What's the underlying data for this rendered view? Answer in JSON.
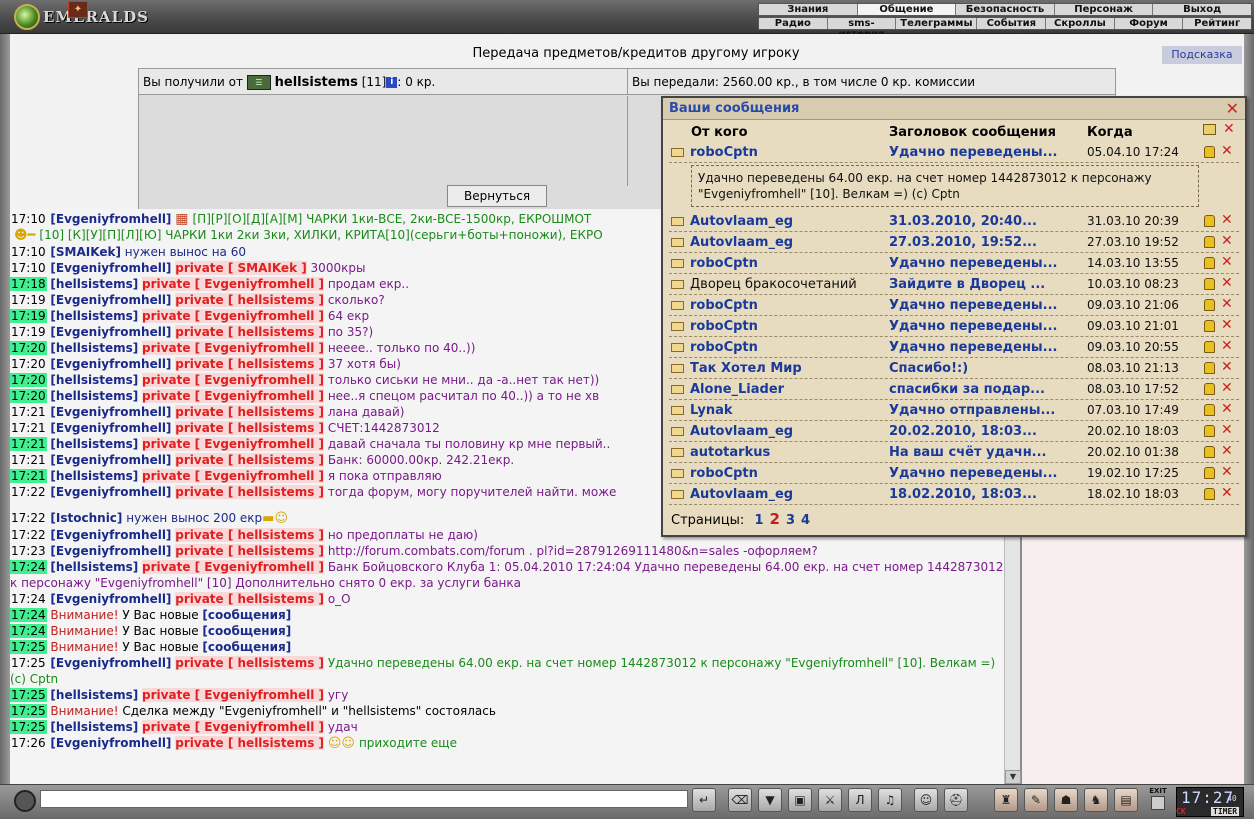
{
  "app": {
    "logo_text": "EMERALDS"
  },
  "nav": {
    "top": [
      "Знания",
      "Общение",
      "Безопасность",
      "Персонаж",
      "Выход"
    ],
    "active": "Общение",
    "sub": [
      "Радио",
      "sms-история",
      "Телеграммы",
      "События",
      "Скроллы",
      "Форум",
      "Рейтинг"
    ]
  },
  "transfer": {
    "title": "Передача предметов/кредитов другому игроку",
    "hint_button": "Подсказка",
    "received_prefix": "Вы получили от",
    "received_from": "hellsistems",
    "received_level": "[11]",
    "received_amount": ": 0 кр.",
    "sent_text": "Вы передали: 2560.00 кр., в том числе 0 кр. комиссии",
    "return_button": "Вернуться"
  },
  "chat": {
    "lines": [
      {
        "time": "17:10",
        "hl": false,
        "name": "Evgeniyfromhell",
        "priv": "",
        "text": "[П][Р][О][Д][А][М] ЧАРКИ 1ки-ВСЕ, 2ки-ВСЕ-1500кр, ЕКРОШМОТ",
        "style": "g",
        "icon_before": "brick"
      },
      {
        "time": "",
        "hl": false,
        "name": "",
        "priv": "",
        "text": "[10] [К][У][П][Л][Ю] ЧАРКИ 1ки 2ки 3ки, ХИЛКИ, КРИТА[10](серьги+боты+поножи), ЕКРО",
        "style": "g",
        "icon_before": "smile"
      },
      {
        "time": "17:10",
        "hl": false,
        "name": "SMAIKek",
        "priv": "",
        "text": "нужен вынос на 60",
        "style": "n2"
      },
      {
        "time": "17:10",
        "hl": false,
        "name": "Evgeniyfromhell",
        "priv": "SMAIKek",
        "text": "3000кры",
        "style": "m"
      },
      {
        "time": "17:18",
        "hl": true,
        "name": "hellsistems",
        "priv": "Evgeniyfromhell",
        "text": "продам екр..",
        "style": "m"
      },
      {
        "time": "17:19",
        "hl": false,
        "name": "Evgeniyfromhell",
        "priv": "hellsistems",
        "text": "сколько?",
        "style": "m"
      },
      {
        "time": "17:19",
        "hl": true,
        "name": "hellsistems",
        "priv": "Evgeniyfromhell",
        "text": "64 екр",
        "style": "m"
      },
      {
        "time": "17:19",
        "hl": false,
        "name": "Evgeniyfromhell",
        "priv": "hellsistems",
        "text": "по 35?)",
        "style": "m"
      },
      {
        "time": "17:20",
        "hl": true,
        "name": "hellsistems",
        "priv": "Evgeniyfromhell",
        "text": "нееее.. только по 40..))",
        "style": "m"
      },
      {
        "time": "17:20",
        "hl": false,
        "name": "Evgeniyfromhell",
        "priv": "hellsistems",
        "text": "37 хотя бы)",
        "style": "m"
      },
      {
        "time": "17:20",
        "hl": true,
        "name": "hellsistems",
        "priv": "Evgeniyfromhell",
        "text": "только сиськи не мни.. да -а..нет так нет))",
        "style": "m"
      },
      {
        "time": "17:20",
        "hl": true,
        "name": "hellsistems",
        "priv": "Evgeniyfromhell",
        "text": "нее..я спецом расчитал по 40..)) а то не хв",
        "style": "m"
      },
      {
        "time": "17:21",
        "hl": false,
        "name": "Evgeniyfromhell",
        "priv": "hellsistems",
        "text": "лана давай)",
        "style": "m"
      },
      {
        "time": "17:21",
        "hl": false,
        "name": "Evgeniyfromhell",
        "priv": "hellsistems",
        "text": "СЧЕТ:1442873012",
        "style": "m"
      },
      {
        "time": "17:21",
        "hl": true,
        "name": "hellsistems",
        "priv": "Evgeniyfromhell",
        "text": "давай сначала ты половину кр мне первый..",
        "style": "m"
      },
      {
        "time": "17:21",
        "hl": false,
        "name": "Evgeniyfromhell",
        "priv": "hellsistems",
        "text": "Банк: 60000.00кр. 242.21екр.",
        "style": "m"
      },
      {
        "time": "17:21",
        "hl": true,
        "name": "hellsistems",
        "priv": "Evgeniyfromhell",
        "text": "я пока отправляю",
        "style": "m"
      },
      {
        "time": "17:22",
        "hl": false,
        "name": "Evgeniyfromhell",
        "priv": "hellsistems",
        "text": "тогда форум, могу поручителей найти. може",
        "style": "m"
      },
      {
        "gap": true
      },
      {
        "time": "17:22",
        "hl": false,
        "name": "Istochnic",
        "priv": "",
        "text": "нужен вынос 200 екр",
        "style": "n2",
        "icon_after": "gun"
      },
      {
        "time": "17:22",
        "hl": false,
        "name": "Evgeniyfromhell",
        "priv": "hellsistems",
        "text": "но предоплаты не даю)",
        "style": "m"
      },
      {
        "time": "17:23",
        "hl": false,
        "name": "Evgeniyfromhell",
        "priv": "hellsistems",
        "text": "http://forum.combats.com/forum . pl?id=28791269111480&n=sales -офорляем?",
        "style": "m"
      },
      {
        "time": "17:24",
        "hl": true,
        "name": "hellsistems",
        "priv": "Evgeniyfromhell",
        "text": "Банк Бойцовского Клуба 1: 05.04.2010 17:24:04 Удачно переведены 64.00 екр. на счет номер 1442873012 к персонажу \"Evgeniyfromhell\" [10] Дополнительно снято 0 екр. за услуги банка",
        "style": "m",
        "wrap": true
      },
      {
        "time": "17:24",
        "hl": false,
        "name": "Evgeniyfromhell",
        "priv": "hellsistems",
        "text": "о_О",
        "style": "m"
      },
      {
        "time": "17:24",
        "hl": true,
        "warn": true,
        "warn_label": "Внимание!",
        "text": "У Вас новые",
        "msg_link": "[сообщения]"
      },
      {
        "time": "17:24",
        "hl": true,
        "warn": true,
        "warn_label": "Внимание!",
        "text": "У Вас новые",
        "msg_link": "[сообщения]"
      },
      {
        "time": "17:25",
        "hl": true,
        "warn": true,
        "warn_label": "Внимание!",
        "text": "У Вас новые",
        "msg_link": "[сообщения]"
      },
      {
        "time": "17:25",
        "hl": false,
        "name": "Evgeniyfromhell",
        "priv": "hellsistems",
        "text": "Удачно переведены 64.00 екр. на счет номер 1442873012 к персонажу \"Evgeniyfromhell\" [10]. Велкам =) (c) Cptn",
        "style": "g",
        "wrap": true
      },
      {
        "time": "17:25",
        "hl": true,
        "name": "hellsistems",
        "priv": "Evgeniyfromhell",
        "text": "угу",
        "style": "m"
      },
      {
        "time": "17:25",
        "hl": true,
        "warn": true,
        "warn_label": "Внимание!",
        "text": "Сделка между \"Evgeniyfromhell\" и \"hellsistems\" состоялась",
        "msg_link": ""
      },
      {
        "time": "17:25",
        "hl": true,
        "name": "hellsistems",
        "priv": "Evgeniyfromhell",
        "text": "удач",
        "style": "m"
      },
      {
        "time": "17:26",
        "hl": false,
        "name": "Evgeniyfromhell",
        "priv": "hellsistems",
        "text": "приходите еще",
        "style": "g",
        "icon_before": "smile2"
      }
    ],
    "private_label": "private"
  },
  "messages": {
    "title": "Ваши сообщения",
    "col_from": "От кого",
    "col_subject": "Заголовок сообщения",
    "col_when": "Когда",
    "expanded_text": "Удачно переведены 64.00 екр. на счет номер 1442873012 к персонажу \"Evgeniyfromhell\" [10]. Велкам =) (c) Cptn",
    "rows": [
      {
        "from": "roboCptn",
        "subject": "Удачно переведены...",
        "when": "05.04.10 17:24",
        "plain": false
      },
      {
        "from": "Autovlaam_eg",
        "subject": "31.03.2010, 20:40...",
        "when": "31.03.10 20:39",
        "plain": false
      },
      {
        "from": "Autovlaam_eg",
        "subject": "27.03.2010, 19:52...",
        "when": "27.03.10 19:52",
        "plain": false
      },
      {
        "from": "roboCptn",
        "subject": "Удачно переведены...",
        "when": "14.03.10 13:55",
        "plain": false
      },
      {
        "from": "Дворец бракосочетаний",
        "subject": "Зайдите в Дворец ...",
        "when": "10.03.10 08:23",
        "plain": true
      },
      {
        "from": "roboCptn",
        "subject": "Удачно переведены...",
        "when": "09.03.10 21:06",
        "plain": false
      },
      {
        "from": "roboCptn",
        "subject": "Удачно переведены...",
        "when": "09.03.10 21:01",
        "plain": false
      },
      {
        "from": "roboCptn",
        "subject": "Удачно переведены...",
        "when": "09.03.10 20:55",
        "plain": false
      },
      {
        "from": "Так Хотел Мир",
        "subject": "Спасибо!:)",
        "when": "08.03.10 21:13",
        "plain": false
      },
      {
        "from": "Alone_Liader",
        "subject": "спасибки за подар...",
        "when": "08.03.10 17:52",
        "plain": false
      },
      {
        "from": "Lynak",
        "subject": "Удачно отправлены...",
        "when": "07.03.10 17:49",
        "plain": false
      },
      {
        "from": "Autovlaam_eg",
        "subject": "20.02.2010, 18:03...",
        "when": "20.02.10 18:03",
        "plain": false
      },
      {
        "from": "autotarkus",
        "subject": "На ваш счёт удачн...",
        "when": "20.02.10 01:38",
        "plain": false
      },
      {
        "from": "roboCptn",
        "subject": "Удачно переведены...",
        "when": "19.02.10 17:25",
        "plain": false
      },
      {
        "from": "Autovlaam_eg",
        "subject": "18.02.2010, 18:03...",
        "when": "18.02.10 18:03",
        "plain": false
      }
    ],
    "pages_label": "Страницы:",
    "pages": [
      "1",
      "2",
      "3",
      "4"
    ],
    "current_page": "2"
  },
  "toolbar": {
    "clock": "17:27",
    "clock_seconds": "40",
    "timer_label": "TIMER",
    "ck_label": "CK",
    "exit_label": "EXIT"
  }
}
